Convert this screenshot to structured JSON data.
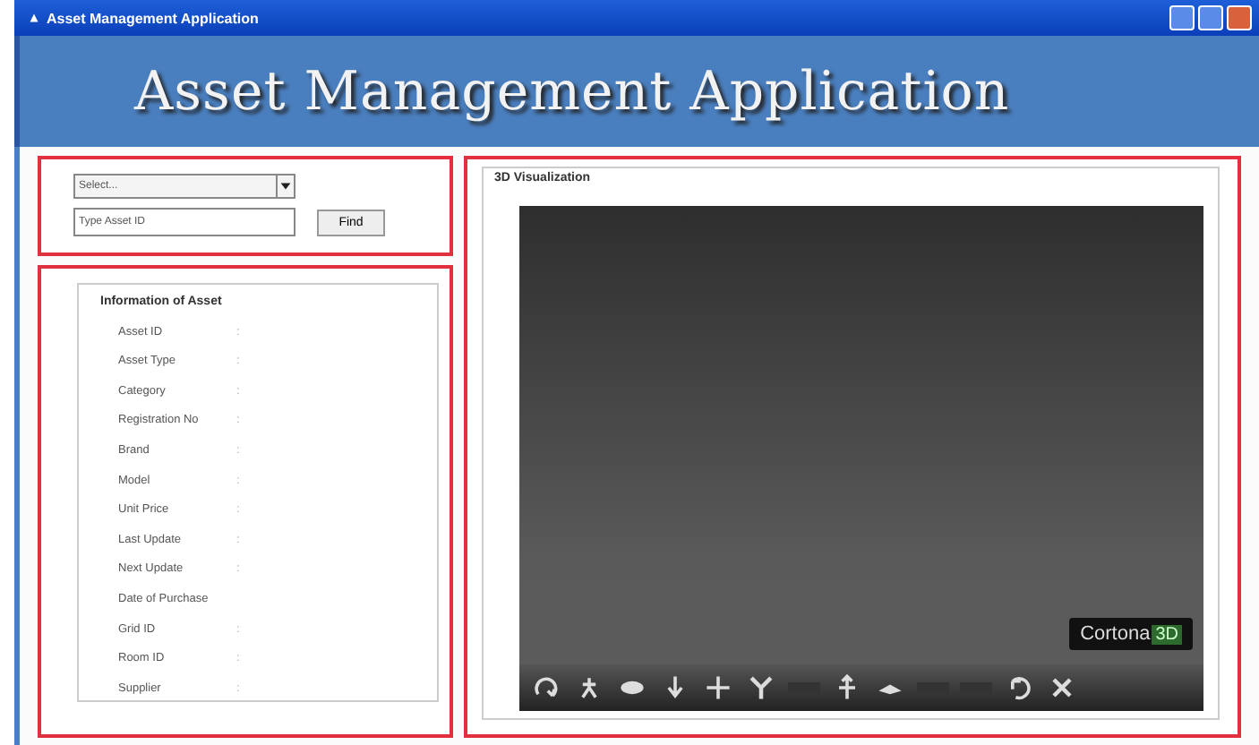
{
  "window": {
    "title": "Asset Management Application"
  },
  "header": {
    "title": "Asset Management Application"
  },
  "search": {
    "select_placeholder": "Select...",
    "id_placeholder": "Type Asset ID",
    "find_button": "Find"
  },
  "info": {
    "title": "Information of Asset",
    "fields": [
      {
        "label": "Asset ID",
        "separator": ":"
      },
      {
        "label": "Asset Type",
        "separator": ":"
      },
      {
        "label": "Category",
        "separator": ":"
      },
      {
        "label": "Registration No",
        "separator": ":"
      },
      {
        "label": "Brand",
        "separator": ":"
      },
      {
        "label": "Model",
        "separator": ":"
      },
      {
        "label": "Unit Price",
        "separator": ":"
      },
      {
        "label": "Last Update",
        "separator": ":"
      },
      {
        "label": "Next Update",
        "separator": ":"
      },
      {
        "label": "Date of Purchase"
      },
      {
        "label": "Grid ID",
        "separator": ":"
      },
      {
        "label": "Room ID",
        "separator": ":"
      },
      {
        "label": "Supplier",
        "separator": ":"
      }
    ]
  },
  "viewer": {
    "title": "3D Visualization",
    "logo": {
      "name": "Cortona",
      "suffix": "3D"
    }
  }
}
